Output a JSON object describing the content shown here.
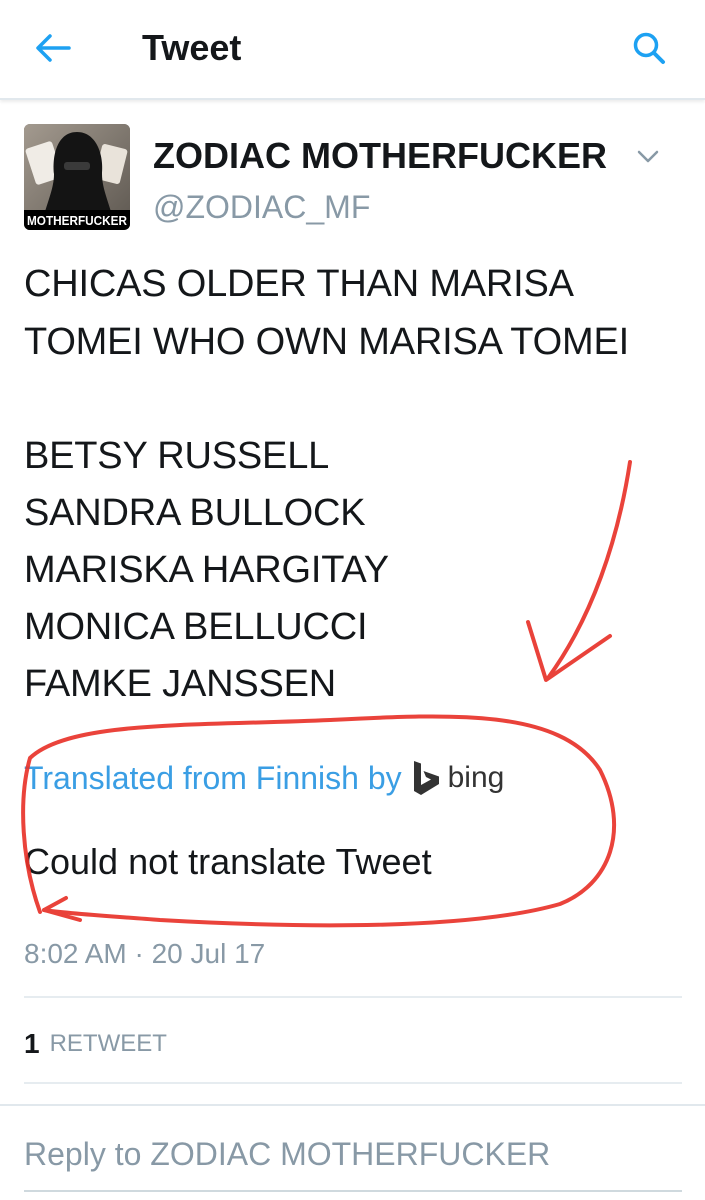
{
  "header": {
    "title": "Tweet",
    "back_icon": "back-arrow-icon",
    "search_icon": "search-icon",
    "accent_color": "#1da1f2"
  },
  "author": {
    "display_name": "ZODIAC MOTHERFUCKER",
    "handle": "@ZODIAC_MF",
    "avatar_caption": "MOTHERFUCKER"
  },
  "tweet": {
    "lines": [
      "CHICAS OLDER THAN MARISA",
      "TOMEI WHO OWN MARISA TOMEI",
      "BETSY RUSSELL",
      "SANDRA BULLOCK",
      "MARISKA HARGITAY",
      "MONICA BELLUCCI",
      "FAMKE JANSSEN"
    ]
  },
  "translation": {
    "label": "Translated from Finnish by",
    "provider": "bing",
    "result": "Could not translate Tweet",
    "link_color": "#3a9ee4"
  },
  "meta": {
    "timestamp": "8:02 AM · 20 Jul 17"
  },
  "stats": {
    "retweet_count": "1",
    "retweet_label": "RETWEET"
  },
  "reply": {
    "placeholder": "Reply to ZODIAC MOTHERFUCKER"
  },
  "annotation": {
    "color": "#e8332a"
  }
}
